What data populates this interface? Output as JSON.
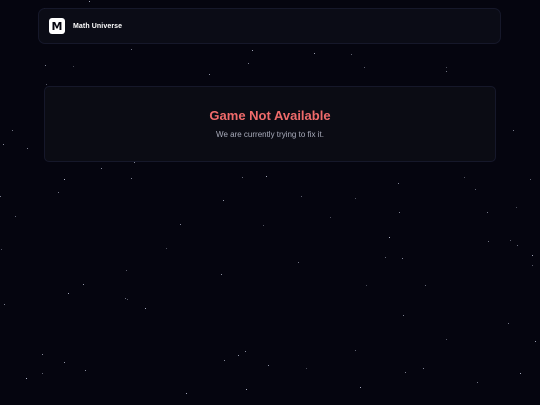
{
  "navbar": {
    "logo_letter": "M",
    "brand_name": "Math Universe"
  },
  "error_card": {
    "title": "Game Not Available",
    "message": "We are currently trying to fix it."
  },
  "colors": {
    "background": "#05050f",
    "error_title": "#f06b6b",
    "message_text": "#a9acbb",
    "card_border": "#16182a"
  }
}
